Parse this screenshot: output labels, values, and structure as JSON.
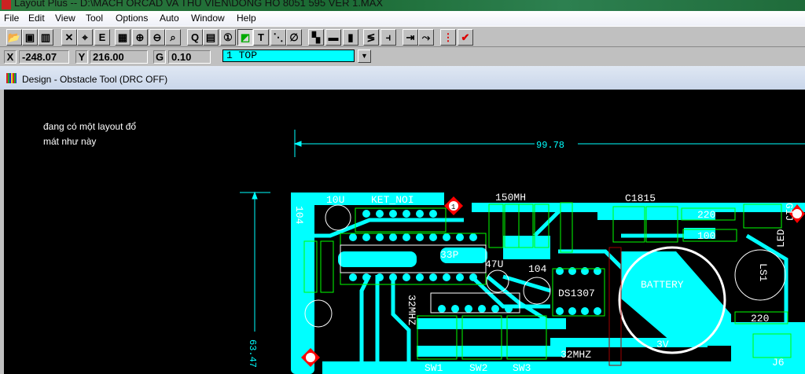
{
  "window": {
    "title": "Layout Plus -- D:\\MACH ORCAD VA THU VIEN\\DONG HO 8051 595 VER 1.MAX"
  },
  "menu": [
    "File",
    "Edit",
    "View",
    "Tool",
    "Options",
    "Auto",
    "Window",
    "Help"
  ],
  "toolbar": [
    {
      "name": "open-icon",
      "glyph": "📂"
    },
    {
      "name": "save-icon",
      "glyph": "▣"
    },
    {
      "name": "library-icon",
      "glyph": "▥"
    },
    {
      "name": "delete-icon",
      "glyph": "✕"
    },
    {
      "name": "find-icon",
      "glyph": "⌖"
    },
    {
      "name": "edit-icon",
      "glyph": "E"
    },
    {
      "name": "spreadsheet-icon",
      "glyph": "▦"
    },
    {
      "name": "zoom-in-icon",
      "glyph": "⊕"
    },
    {
      "name": "zoom-out-icon",
      "glyph": "⊖"
    },
    {
      "name": "zoom-all-icon",
      "glyph": "⌕"
    },
    {
      "name": "query-icon",
      "glyph": "Q"
    },
    {
      "name": "component-icon",
      "glyph": "▤"
    },
    {
      "name": "pin-icon",
      "glyph": "①"
    },
    {
      "name": "obstacle-icon",
      "glyph": "◩"
    },
    {
      "name": "text-icon",
      "glyph": "T"
    },
    {
      "name": "connection-icon",
      "glyph": "⋱"
    },
    {
      "name": "error-icon",
      "glyph": "∅"
    },
    {
      "name": "color-icon",
      "glyph": "▚"
    },
    {
      "name": "drc-box-icon",
      "glyph": "▬"
    },
    {
      "name": "strategy-icon",
      "glyph": "▮"
    },
    {
      "name": "edit-segment-icon",
      "glyph": "≶"
    },
    {
      "name": "add-via-icon",
      "glyph": "⫞"
    },
    {
      "name": "shove-track-icon",
      "glyph": "⇥"
    },
    {
      "name": "auto-path-icon",
      "glyph": "⤳"
    },
    {
      "name": "online-drc-icon",
      "glyph": "⋮"
    },
    {
      "name": "drc-check-icon",
      "glyph": "✔"
    }
  ],
  "status": {
    "x_label": "X",
    "x_value": "-248.07",
    "y_label": "Y",
    "y_value": "216.00",
    "g_label": "G",
    "g_value": "0.10",
    "layer": "1 TOP"
  },
  "design": {
    "title": "Design - Obstacle Tool (DRC OFF)"
  },
  "annotation": {
    "line1": "đang có một layout đổ",
    "line2": "mát như này"
  },
  "dimensions": {
    "width": "99.78",
    "height": "63.47"
  },
  "pcb_labels": {
    "c10u": "10U",
    "ket_noi": "KET_NOI",
    "l150": "150MH",
    "c1815": "C1815",
    "c104a": "104",
    "c33p": "33P",
    "c47u": "47U",
    "c104b": "104",
    "ds1307": "DS1307",
    "xtal": "32MHZ",
    "battery": "BATTERY",
    "v3": "3V",
    "ls1": "LS1",
    "led": "LED",
    "r220a": "220",
    "r100": "100",
    "r220b": "220",
    "sw1": "SW1",
    "sw2": "SW2",
    "sw3": "SW3",
    "j6": "J6",
    "g1j": "G1J",
    "pin1": "1",
    "xtal2": "32MHZ"
  },
  "colors": {
    "copper": "#00ffff",
    "silk": "#ffffff",
    "outline": "#00ff00",
    "marker": "#ff0000"
  }
}
